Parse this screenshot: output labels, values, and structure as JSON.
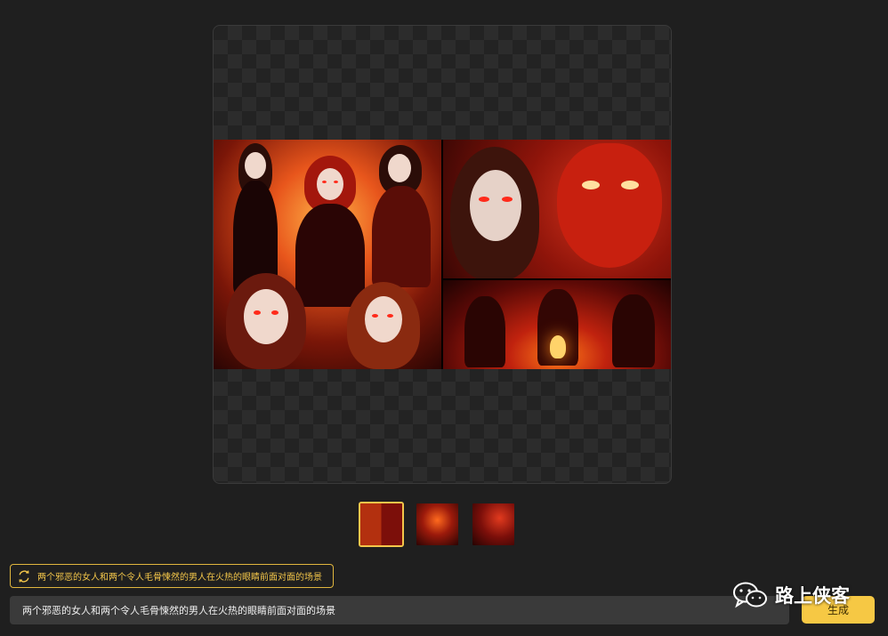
{
  "prompt": {
    "chip_text": "两个邪恶的女人和两个令人毛骨悚然的男人在火热的眼睛前面对面的场景",
    "input_value": "两个邪恶的女人和两个令人毛骨悚然的男人在火热的眼睛前面对面的场景"
  },
  "actions": {
    "generate_label": "生成"
  },
  "thumbnails": {
    "selected_index": 0,
    "count": 3
  },
  "watermark": {
    "text": "路上侠客",
    "icon": "wechat-icon"
  },
  "colors": {
    "accent": "#f6c844",
    "chip_border": "#e0b63e",
    "background": "#1f1f1f",
    "input_bg": "#3a3a3a"
  }
}
